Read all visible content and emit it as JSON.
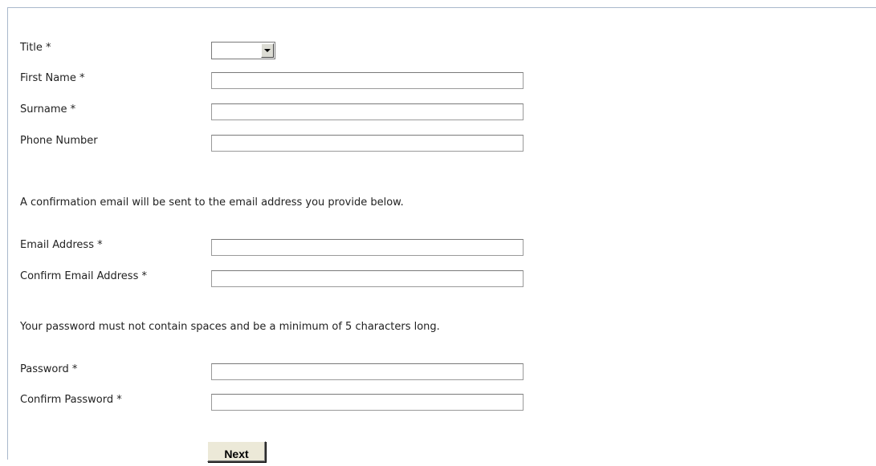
{
  "form": {
    "title_label": "Title *",
    "title_value": "",
    "first_name_label": "First Name *",
    "first_name_value": "",
    "surname_label": "Surname *",
    "surname_value": "",
    "phone_label": "Phone Number",
    "phone_value": "",
    "email_note": "A confirmation email will be sent to the email address you provide below.",
    "email_label": "Email Address *",
    "email_value": "",
    "confirm_email_label": "Confirm Email Address *",
    "confirm_email_value": "",
    "password_note": "Your password must not contain spaces and be a minimum of 5 characters long.",
    "password_label": "Password *",
    "password_value": "",
    "confirm_password_label": "Confirm Password *",
    "confirm_password_value": "",
    "next_label": "Next"
  },
  "colors": {
    "panel_border": "#a9b8cc",
    "input_border": "#9a9a9a",
    "button_face": "#ece9d8"
  }
}
